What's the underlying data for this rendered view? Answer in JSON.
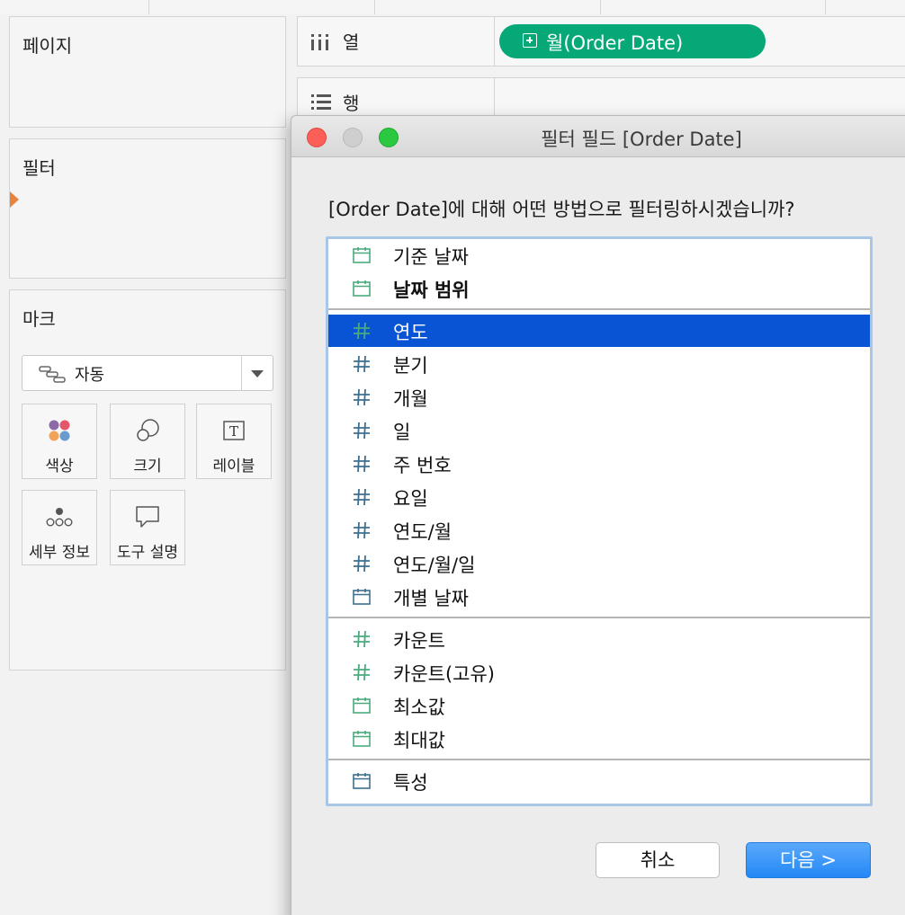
{
  "sidebar": {
    "pages_title": "페이지",
    "filters_title": "필터",
    "marks": {
      "title": "마크",
      "mark_type": "자동",
      "buttons": [
        {
          "label": "색상",
          "icon": "color-dots-icon"
        },
        {
          "label": "크기",
          "icon": "size-circles-icon"
        },
        {
          "label": "레이블",
          "icon": "label-t-icon"
        },
        {
          "label": "세부 정보",
          "icon": "detail-dots-icon"
        },
        {
          "label": "도구 설명",
          "icon": "tooltip-bubble-icon"
        }
      ]
    }
  },
  "shelves": {
    "columns_label": "열",
    "rows_label": "행",
    "columns_pill": "월(Order Date)",
    "pill_color": "#07a878"
  },
  "dialog": {
    "title": "필터 필드 [Order Date]",
    "question": "[Order Date]에 대해 어떤 방법으로 필터링하시겠습니까?",
    "groups": [
      [
        {
          "label": "기준 날짜",
          "icon": "calendar-icon",
          "tone": "green"
        },
        {
          "label": "날짜 범위",
          "icon": "calendar-icon",
          "tone": "green",
          "bold": true
        }
      ],
      [
        {
          "label": "연도",
          "icon": "hash-icon",
          "tone": "green",
          "selected": true
        },
        {
          "label": "분기",
          "icon": "hash-icon",
          "tone": "blue"
        },
        {
          "label": "개월",
          "icon": "hash-icon",
          "tone": "blue"
        },
        {
          "label": "일",
          "icon": "hash-icon",
          "tone": "blue"
        },
        {
          "label": "주 번호",
          "icon": "hash-icon",
          "tone": "blue"
        },
        {
          "label": "요일",
          "icon": "hash-icon",
          "tone": "blue"
        },
        {
          "label": "연도/월",
          "icon": "hash-icon",
          "tone": "blue"
        },
        {
          "label": "연도/월/일",
          "icon": "hash-icon",
          "tone": "blue"
        },
        {
          "label": "개별 날짜",
          "icon": "calendar-icon",
          "tone": "blue"
        }
      ],
      [
        {
          "label": "카운트",
          "icon": "hash-icon",
          "tone": "green"
        },
        {
          "label": "카운트(고유)",
          "icon": "hash-icon",
          "tone": "green"
        },
        {
          "label": "최소값",
          "icon": "calendar-icon",
          "tone": "green"
        },
        {
          "label": "최대값",
          "icon": "calendar-icon",
          "tone": "green"
        }
      ],
      [
        {
          "label": "특성",
          "icon": "calendar-icon",
          "tone": "blue"
        }
      ]
    ],
    "cancel_label": "취소",
    "next_label": "다음 >",
    "colors": {
      "green": "#4bab7d",
      "blue": "#3d6f8f",
      "selected": "#0954d4",
      "accent": "#2488f6"
    }
  }
}
